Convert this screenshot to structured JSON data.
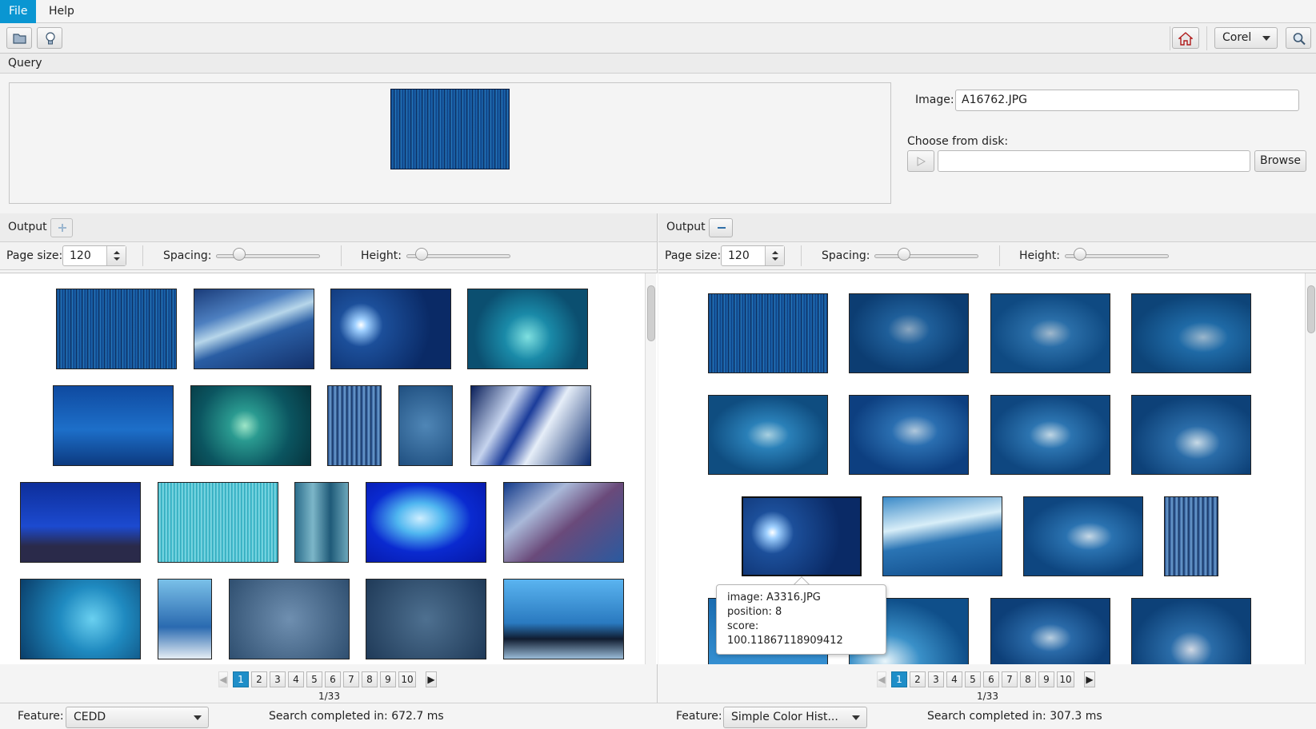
{
  "menu": {
    "file": "File",
    "help": "Help"
  },
  "toolbar": {
    "open_icon": "folder-open-icon",
    "idea_icon": "lightbulb-icon",
    "home_icon": "home-icon",
    "dataset": "Corel",
    "search_icon": "search-icon"
  },
  "query": {
    "title": "Query",
    "image_label": "Image:",
    "image_value": "A16762.JPG",
    "choose_label": "Choose from disk:",
    "path_value": "",
    "browse_label": "Browse"
  },
  "left": {
    "title": "Output",
    "toggle_icon": "plus-icon",
    "page_size_label": "Page size:",
    "page_size_value": "120",
    "spacing_label": "Spacing:",
    "height_label": "Height:",
    "spacing_level": 0.18,
    "height_level": 0.1,
    "pages": [
      "1",
      "2",
      "3",
      "4",
      "5",
      "6",
      "7",
      "8",
      "9",
      "10"
    ],
    "page_info": "1/33",
    "feature_label": "Feature:",
    "feature_value": "CEDD",
    "status": "Search completed in: 672.7 ms"
  },
  "right": {
    "title": "Output",
    "toggle_icon": "minus-icon",
    "page_size_label": "Page size:",
    "page_size_value": "120",
    "spacing_label": "Spacing:",
    "height_label": "Height:",
    "spacing_level": 0.25,
    "height_level": 0.1,
    "pages": [
      "1",
      "2",
      "3",
      "4",
      "5",
      "6",
      "7",
      "8",
      "9",
      "10"
    ],
    "page_info": "1/33",
    "feature_label": "Feature:",
    "feature_value": "Simple Color Hist...",
    "status": "Search completed in: 307.3 ms"
  },
  "tooltip": {
    "image": "image: A3316.JPG",
    "position": "position: 8",
    "score": "score: 100.11867118909412"
  }
}
